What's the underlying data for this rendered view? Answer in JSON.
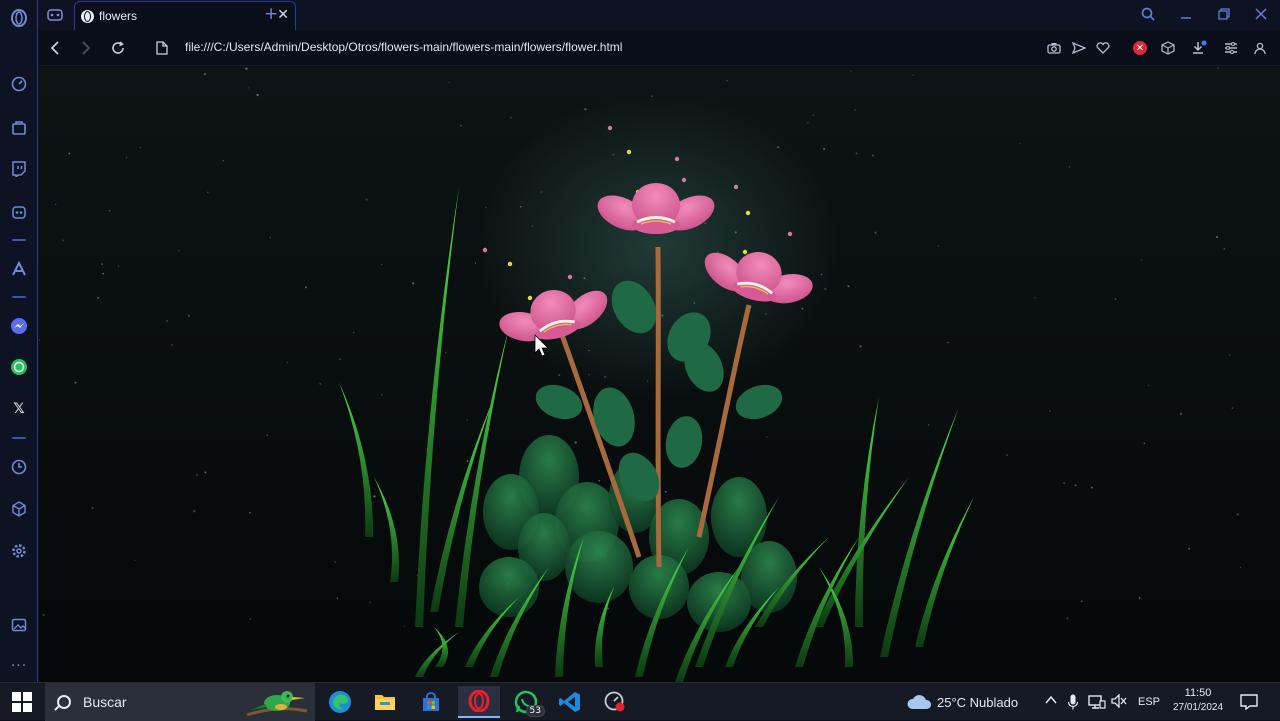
{
  "browser": {
    "tab": {
      "title": "flowers"
    },
    "address": {
      "url": "file:///C:/Users/Admin/Desktop/Otros/flowers-main/flowers-main/flowers/flower.html"
    }
  },
  "taskbar": {
    "search_placeholder": "Buscar",
    "whatsapp_badge": "53",
    "weather": "25°C  Nublado",
    "language": "ESP",
    "time": "11:50",
    "date": "27/01/2024"
  },
  "colors": {
    "accent": "#2a3c8f",
    "petal": "#e06aa0",
    "grass": "#3fbf3a",
    "stem": "#a76a3c"
  }
}
